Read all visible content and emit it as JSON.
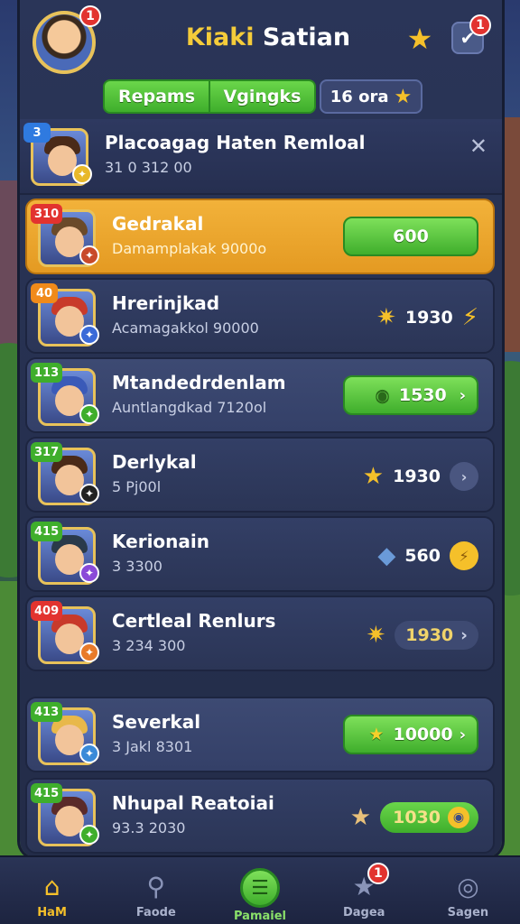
{
  "header": {
    "title_part1": "Kiaki",
    "title_part2": "Satian",
    "avatar_badge": "1",
    "check_badge": "1",
    "tabs": [
      {
        "label": "Repams"
      },
      {
        "label": "Vgingks"
      }
    ],
    "coins": "16 ora"
  },
  "rows": [
    {
      "rank": "3",
      "rank_color": "#2f7ae0",
      "name": "Placoagag Haten Remloal",
      "sub": "31 0 312 00",
      "action": "close",
      "hair": "#4a2a18",
      "mini_color": "#e8b82a"
    },
    {
      "rank": "310",
      "rank_color": "#e2332f",
      "name": "Gedrakal",
      "sub": "Damamplakak 9000o",
      "action": "button",
      "button_label": "600",
      "hair": "#6a4a2a",
      "mini_color": "#c84a2a"
    },
    {
      "rank": "40",
      "rank_color": "#f08a1a",
      "name": "Hrerinjkad",
      "sub": "Acamagakkol 90000",
      "action": "reward",
      "reward_value": "1930",
      "hair": "#c83a2a",
      "mini_color": "#3a6ad8"
    },
    {
      "rank": "113",
      "rank_color": "#3fae2c",
      "name": "Mtandedrdenlam",
      "sub": "Auntlangdkad 7120ol",
      "action": "button_icon",
      "button_label": "1530",
      "hair": "#3a5ab8",
      "mini_color": "#3fae2c"
    },
    {
      "rank": "317",
      "rank_color": "#3fae2c",
      "name": "Derlykal",
      "sub": "5 Pj00l",
      "action": "reward_chev",
      "reward_value": "1930",
      "hair": "#4a2a18",
      "mini_color": "#222222"
    },
    {
      "rank": "415",
      "rank_color": "#3fae2c",
      "name": "Kerionain",
      "sub": "3 3300",
      "action": "reward_circle",
      "reward_value": "560",
      "hair": "#2a3a4a",
      "mini_color": "#8a4ad8"
    },
    {
      "rank": "409",
      "rank_color": "#e2332f",
      "name": "Certleal Renlurs",
      "sub": "3 234 300",
      "action": "reward_pill",
      "reward_value": "1930",
      "hair": "#c83a2a",
      "mini_color": "#e87a2a"
    },
    {
      "rank": "413",
      "rank_color": "#3fae2c",
      "name": "Severkal",
      "sub": "3 Jakl 8301",
      "action": "button_star",
      "button_label": "10000",
      "hair": "#e8b84a",
      "mini_color": "#3a8ad8"
    },
    {
      "rank": "415",
      "rank_color": "#3fae2c",
      "name": "Nhupal Reatoiai",
      "sub": "93.3 2030",
      "action": "reward_greenpill",
      "reward_value": "1030",
      "hair": "#5a2a2a",
      "mini_color": "#3fae2c"
    }
  ],
  "nav": [
    {
      "label": "HaM",
      "icon": "house-icon",
      "glyph": "⌂"
    },
    {
      "label": "Faode",
      "icon": "search-icon",
      "glyph": "⚲"
    },
    {
      "label": "Pamaiel",
      "icon": "menu-icon",
      "glyph": "☰"
    },
    {
      "label": "Dagea",
      "icon": "star-icon",
      "glyph": "★",
      "badge": "1"
    },
    {
      "label": "Sagen",
      "icon": "target-icon",
      "glyph": "◎"
    }
  ]
}
